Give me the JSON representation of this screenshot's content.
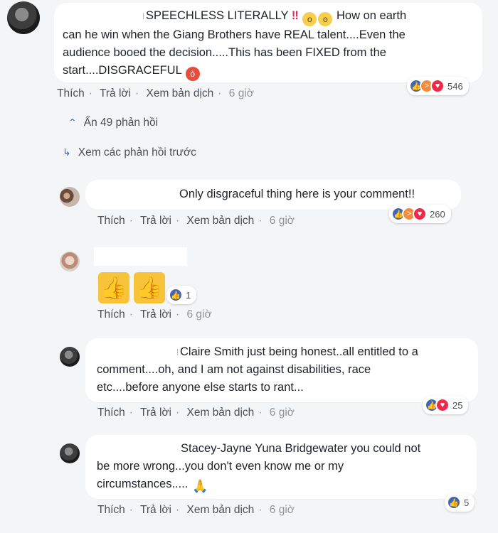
{
  "colors": {
    "like": "#4267b2",
    "angry": "#f28b3a",
    "love": "#f0284a",
    "link": "#4b4f56",
    "bubble": "#ffffff"
  },
  "comments": [
    {
      "lines": [
        "SPEECHLESS LITERALLY",
        "How on earth",
        "can he win when the Giang Brothers have REAL talent....Even the",
        "audience booed the decision.....This has been FIXED from the",
        "start....DISGRACEFUL"
      ],
      "actions": {
        "like": "Thích",
        "reply": "Trả lời",
        "translate": "Xem bản dịch",
        "time": "6 giờ"
      },
      "reaction_count": "546",
      "reaction_icons": [
        "like-icon",
        "angry-icon",
        "love-icon"
      ]
    },
    {
      "lines": [
        "Only disgraceful thing here is your comment!!"
      ],
      "actions": {
        "like": "Thích",
        "reply": "Trả lời",
        "translate": "Xem bản dịch",
        "time": "6 giờ"
      },
      "reaction_count": "260",
      "reaction_icons": [
        "like-icon",
        "angry-icon",
        "love-icon"
      ]
    },
    {
      "lines": [],
      "actions": {
        "like": "Thích",
        "reply": "Trả lời",
        "time": "6 giờ"
      },
      "reaction_count": "1",
      "reaction_icons": [
        "like-icon"
      ],
      "stickers": [
        "thumbs-up-icon",
        "thumbs-up-icon"
      ]
    },
    {
      "lines": [
        "Claire Smith just being honest..all entitled to a",
        "comment....oh, and I am not against disabilities, race",
        "etc....before anyone else starts to rant..."
      ],
      "actions": {
        "like": "Thích",
        "reply": "Trả lời",
        "translate": "Xem bản dịch",
        "time": "6 giờ"
      },
      "reaction_count": "25",
      "reaction_icons": [
        "like-icon",
        "love-icon"
      ]
    },
    {
      "lines": [
        "Stacey-Jayne Yuna Bridgewater you could not",
        "be more wrong...you don't even know me or my",
        "circumstances....."
      ],
      "actions": {
        "like": "Thích",
        "reply": "Trả lời",
        "translate": "Xem bản dịch",
        "time": "6 giờ"
      },
      "reaction_count": "5",
      "reaction_icons": [
        "like-icon"
      ]
    }
  ],
  "threads": {
    "hide_replies": "Ẩn 49 phản hồi",
    "previous_replies": "Xem các phản hồi trước"
  }
}
